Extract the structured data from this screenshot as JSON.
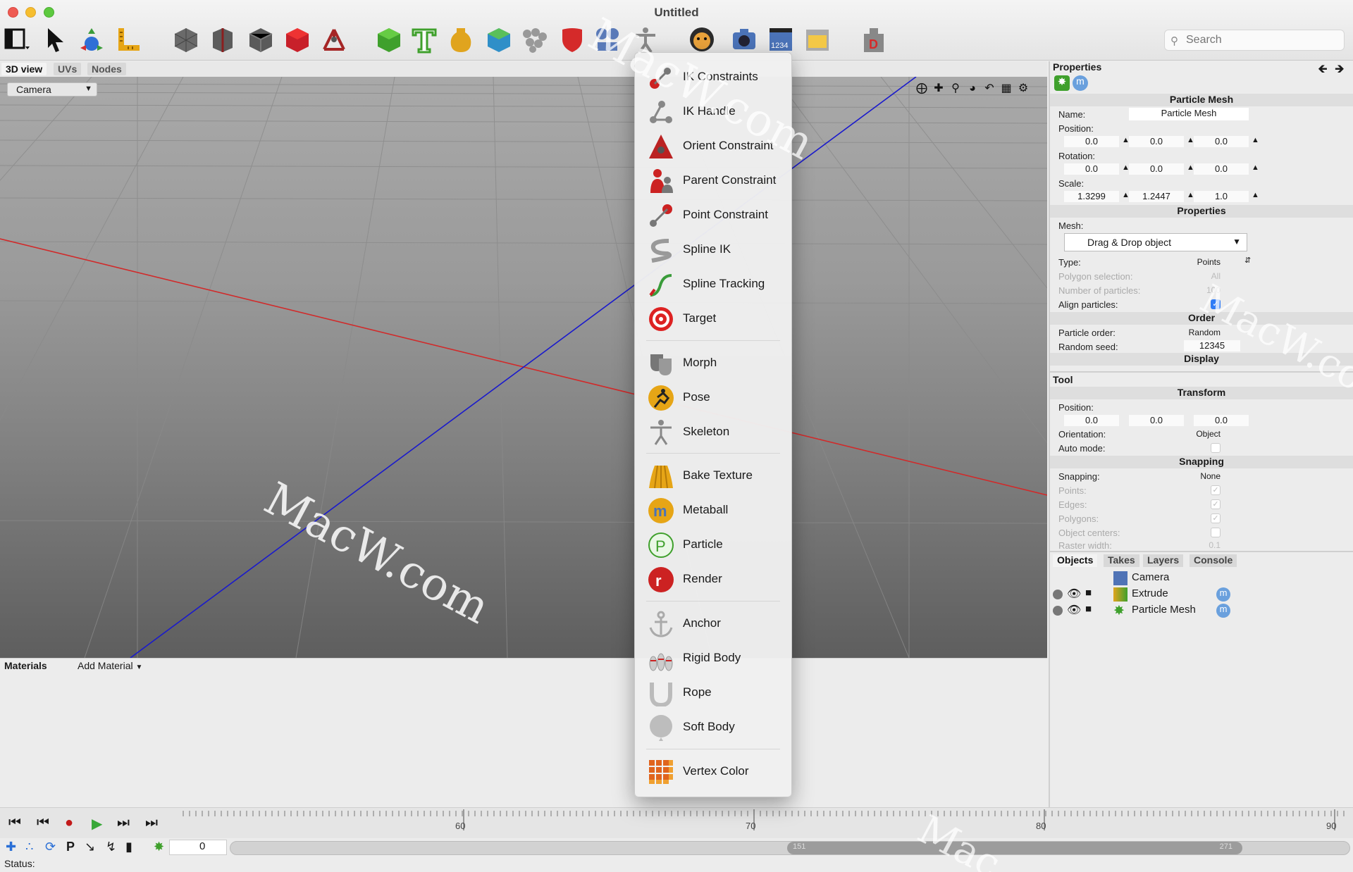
{
  "window": {
    "title": "Untitled"
  },
  "toolbar": {
    "icons": [
      "layout-icon",
      "select-arrow-icon",
      "transform-tool-icon",
      "measure-icon",
      "mesh-object-icon",
      "deform-icon",
      "subdivision-icon",
      "red-cube-icon",
      "joint-icon",
      "green-cube-icon",
      "text-icon",
      "lathe-icon",
      "box-icon",
      "sphere-cluster-icon",
      "shield-icon",
      "constraints-icon",
      "figure-icon",
      "tiger-icon",
      "camera-icon",
      "render-clip-icon",
      "window-icon",
      "d-plugin-icon"
    ],
    "search_placeholder": "Search"
  },
  "view_tabs": [
    "3D view",
    "UVs",
    "Nodes"
  ],
  "viewport": {
    "camera_label": "Camera"
  },
  "menu": {
    "groups": [
      [
        "IK Constraints",
        "IK Handle",
        "Orient Constraint",
        "Parent Constraint",
        "Point Constraint",
        "Spline IK",
        "Spline Tracking",
        "Target"
      ],
      [
        "Morph",
        "Pose",
        "Skeleton"
      ],
      [
        "Bake Texture",
        "Metaball",
        "Particle",
        "Render"
      ],
      [
        "Anchor",
        "Rigid Body",
        "Rope",
        "Soft Body"
      ],
      [
        "Vertex Color"
      ]
    ]
  },
  "materials": {
    "title": "Materials",
    "add_label": "Add Material"
  },
  "properties": {
    "title": "Properties",
    "object_title": "Particle Mesh",
    "name_label": "Name:",
    "name_value": "Particle Mesh",
    "position_label": "Position:",
    "position": [
      "0.0",
      "0.0",
      "0.0"
    ],
    "rotation_label": "Rotation:",
    "rotation": [
      "0.0",
      "0.0",
      "0.0"
    ],
    "scale_label": "Scale:",
    "scale": [
      "1.3299",
      "1.2447",
      "1.0"
    ],
    "props_header": "Properties",
    "mesh_label": "Mesh:",
    "mesh_value": "Drag & Drop object",
    "type_label": "Type:",
    "type_value": "Points",
    "polysel_label": "Polygon selection:",
    "polysel_value": "All",
    "numparticles_label": "Number of particles:",
    "numparticles_value": "100",
    "align_label": "Align particles:",
    "order_header": "Order",
    "order_label": "Particle order:",
    "order_value": "Random",
    "seed_label": "Random seed:",
    "seed_value": "12345",
    "display_header": "Display"
  },
  "tool": {
    "title": "Tool",
    "transform_header": "Transform",
    "position_label": "Position:",
    "position": [
      "0.0",
      "0.0",
      "0.0"
    ],
    "orientation_label": "Orientation:",
    "orientation_value": "Object",
    "auto_label": "Auto mode:",
    "snapping_header": "Snapping",
    "snapping_label": "Snapping:",
    "snapping_value": "None",
    "points_label": "Points:",
    "edges_label": "Edges:",
    "polygons_label": "Polygons:",
    "centers_label": "Object centers:",
    "raster_label": "Raster width:",
    "raster_value": "0.1"
  },
  "objects": {
    "tabs": [
      "Objects",
      "Takes",
      "Layers",
      "Console"
    ],
    "items": [
      "Camera",
      "Extrude",
      "Particle Mesh"
    ]
  },
  "timeline": {
    "labels": [
      "60",
      "70",
      "80",
      "90"
    ],
    "frame": "0",
    "range_start": "151",
    "range_end": "271"
  },
  "status": {
    "label": "Status:"
  },
  "watermark": {
    "text_1": "MacW.com",
    "text_2": "MacW.com",
    "text_3": "MacW.com",
    "text_4": "Mac"
  }
}
